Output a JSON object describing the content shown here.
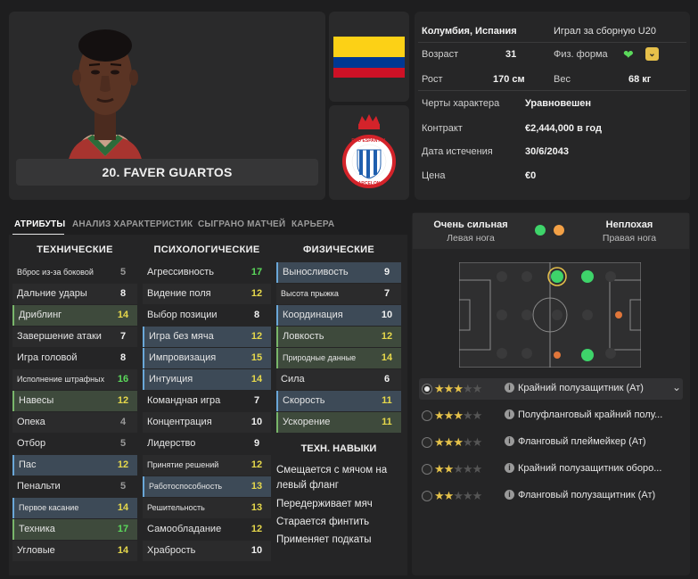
{
  "player": {
    "name_label": "20. FAVER GUARTOS"
  },
  "info": {
    "nationality": "Колумбия, Испания",
    "intl": "Играл за сборную U20",
    "age_label": "Возраст",
    "age": "31",
    "form_label": "Физ. форма",
    "height_label": "Рост",
    "height": "170 см",
    "weight_label": "Вес",
    "weight": "68 кг",
    "personality_label": "Черты характера",
    "personality": "Уравновешен",
    "contract_label": "Контракт",
    "contract": "€2,444,000 в год",
    "expiry_label": "Дата истечения",
    "expiry": "30/6/2043",
    "price_label": "Цена",
    "price": "€0"
  },
  "club": {
    "badge_text": "RCD ESPANYOL DE BARCELONA"
  },
  "colors": {
    "accent_green": "#5bd95b",
    "accent_yellow": "#e6d84b",
    "accent_blue": "#6aa7d8",
    "flag_yellow": "#fcd116",
    "flag_blue": "#003893",
    "flag_red": "#ce1126"
  },
  "tabs": [
    "АТРИБУТЫ",
    "АНАЛИЗ ХАРАКТЕРИСТИК",
    "СЫГРАНО МАТЧЕЙ",
    "КАРЬЕРА"
  ],
  "columns": {
    "technical": {
      "title": "ТЕХНИЧЕСКИЕ",
      "items": [
        {
          "n": "Вброс из-за боковой",
          "v": "5"
        },
        {
          "n": "Дальние удары",
          "v": "8"
        },
        {
          "n": "Дриблинг",
          "v": "14"
        },
        {
          "n": "Завершение атаки",
          "v": "7"
        },
        {
          "n": "Игра головой",
          "v": "8"
        },
        {
          "n": "Исполнение штрафных",
          "v": "16"
        },
        {
          "n": "Навесы",
          "v": "12"
        },
        {
          "n": "Опека",
          "v": "4"
        },
        {
          "n": "Отбор",
          "v": "5"
        },
        {
          "n": "Пас",
          "v": "12"
        },
        {
          "n": "Пенальти",
          "v": "5"
        },
        {
          "n": "Первое касание",
          "v": "14"
        },
        {
          "n": "Техника",
          "v": "17"
        },
        {
          "n": "Угловые",
          "v": "14"
        }
      ]
    },
    "mental": {
      "title": "ПСИХОЛОГИЧЕСКИЕ",
      "items": [
        {
          "n": "Агрессивность",
          "v": "17"
        },
        {
          "n": "Видение поля",
          "v": "12"
        },
        {
          "n": "Выбор позиции",
          "v": "8"
        },
        {
          "n": "Игра без мяча",
          "v": "12"
        },
        {
          "n": "Импровизация",
          "v": "15"
        },
        {
          "n": "Интуиция",
          "v": "14"
        },
        {
          "n": "Командная игра",
          "v": "7"
        },
        {
          "n": "Концентрация",
          "v": "10"
        },
        {
          "n": "Лидерство",
          "v": "9"
        },
        {
          "n": "Принятие решений",
          "v": "12"
        },
        {
          "n": "Работоспособность",
          "v": "13"
        },
        {
          "n": "Решительность",
          "v": "13"
        },
        {
          "n": "Самообладание",
          "v": "12"
        },
        {
          "n": "Храбрость",
          "v": "10"
        }
      ]
    },
    "physical": {
      "title": "ФИЗИЧЕСКИЕ",
      "items": [
        {
          "n": "Выносливость",
          "v": "9"
        },
        {
          "n": "Высота прыжка",
          "v": "7"
        },
        {
          "n": "Координация",
          "v": "10"
        },
        {
          "n": "Ловкость",
          "v": "12"
        },
        {
          "n": "Природные данные",
          "v": "14"
        },
        {
          "n": "Сила",
          "v": "6"
        },
        {
          "n": "Скорость",
          "v": "11"
        },
        {
          "n": "Ускорение",
          "v": "11"
        }
      ]
    }
  },
  "tech_skills": {
    "title": "ТЕХН. НАВЫКИ",
    "items": [
      "Смещается с мячом на",
      "левый фланг",
      "Передерживает мяч",
      "Старается финтить",
      "Применяет подкаты"
    ]
  },
  "feet": {
    "left_level": "Очень сильная",
    "left_label": "Левая нога",
    "right_level": "Неплохая",
    "right_label": "Правая нога"
  },
  "roles": [
    {
      "name": "Крайний полузащитник (Ат)",
      "stars": 2.5,
      "active": true
    },
    {
      "name": "Полуфланговый крайний полу...",
      "stars": 2.5,
      "active": false
    },
    {
      "name": "Фланговый плеймейкер (Ат)",
      "stars": 2.5,
      "active": false
    },
    {
      "name": "Крайний полузащитник оборо...",
      "stars": 2,
      "active": false
    },
    {
      "name": "Фланговый полузащитник (Ат)",
      "stars": 2,
      "active": false
    }
  ]
}
